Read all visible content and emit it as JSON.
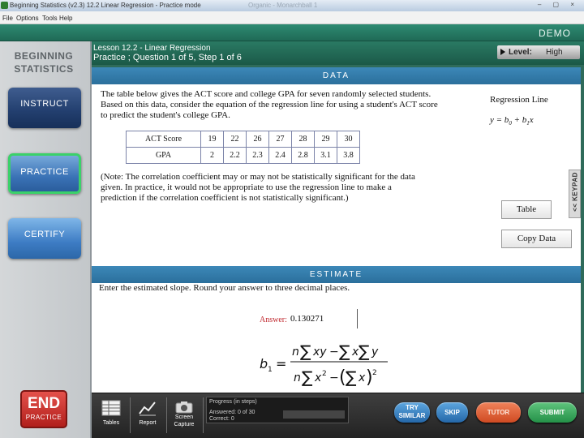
{
  "window": {
    "title": "Beginning Statistics (v2.3)   12.2 Linear Regression - Practice mode",
    "ghost_title": "Organic - Monarchball 1",
    "controls": "– ▢ ×"
  },
  "menu": [
    "File",
    "Options",
    "Tools",
    "Help"
  ],
  "banner": {
    "label": "DEMO"
  },
  "sidebar": {
    "brand_line1": "BEGINNING",
    "brand_line2": "STATISTICS",
    "instruct": "INSTRUCT",
    "practice": "PRACTICE",
    "certify": "CERTIFY",
    "end_big": "END",
    "end_small": "PRACTICE"
  },
  "lesson": {
    "title": "Lesson 12.2 - Linear Regression",
    "subtitle": "Practice ; Question 1 of 5, Step 1 of 6",
    "level_label": "Level:",
    "level_value": "High"
  },
  "data_section": {
    "header": "DATA",
    "intro": "The table below gives the ACT score and college GPA for seven randomly selected students.  Based on this data, consider the equation of the regression line for using a student's ACT score to predict the student's college GPA.",
    "table": {
      "row1_label": "ACT Score",
      "row1": [
        "19",
        "22",
        "26",
        "27",
        "28",
        "29",
        "30"
      ],
      "row2_label": "GPA",
      "row2": [
        "2",
        "2.2",
        "2.3",
        "2.4",
        "2.8",
        "3.1",
        "3.8"
      ]
    },
    "note": "(Note: The correlation coefficient may or may not be statistically significant for the data given. In practice, it would not be appropriate to use the regression line to make a prediction if the correlation coefficient is not statistically significant.)",
    "regression_label": "Regression Line",
    "regression_eq_y": "y = b",
    "regression_eq_mid": " + b",
    "regression_eq_x": "x",
    "table_button": "Table",
    "copy_button": "Copy Data",
    "keypad": "KEYPAD",
    "keypad_arrow": "<<"
  },
  "estimate_section": {
    "header": "ESTIMATE",
    "prompt": "Enter the estimated slope.  Round your answer to three decimal places.",
    "answer_label": "Answer:",
    "answer_value": "0.130271"
  },
  "toolbar": {
    "tables": "Tables",
    "report": "Report",
    "screen_capture_1": "Screen",
    "screen_capture_2": "Capture",
    "progress_title": "Progress (in steps)",
    "answered": "Answered:  0  of  30",
    "correct": "Correct:    0",
    "progress_fraction": 0,
    "try_similar_1": "TRY",
    "try_similar_2": "SIMILAR",
    "skip": "SKIP",
    "tutor": "TUTOR",
    "submit": "SUBMIT"
  }
}
